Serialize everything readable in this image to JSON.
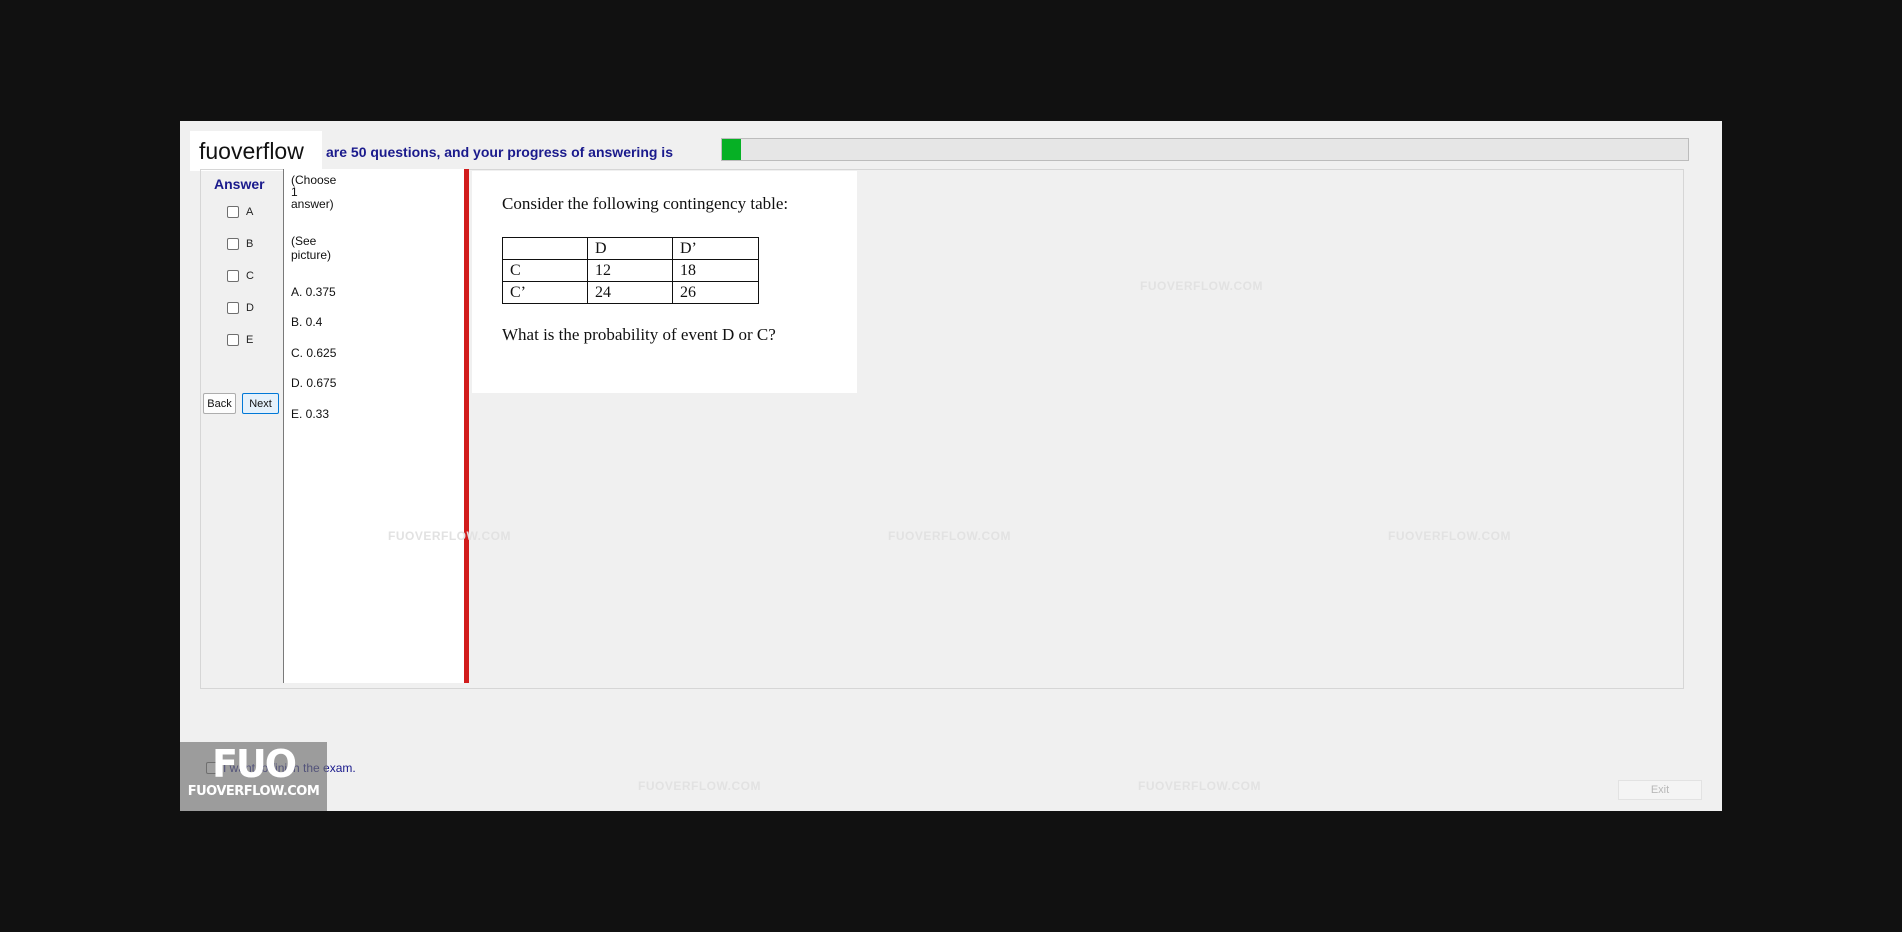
{
  "brand": {
    "logo_text": "fuoverflow"
  },
  "header": {
    "progress_text": "are 50 questions, and your progress of answering is",
    "progress_fraction": 0.02
  },
  "answer_panel": {
    "title": "Answer",
    "options": [
      "A",
      "B",
      "C",
      "D",
      "E"
    ],
    "back_label": "Back",
    "next_label": "Next"
  },
  "question_panel": {
    "instruction_lines": [
      "(Choose",
      "1",
      "answer)"
    ],
    "see_picture_lines": [
      "(See",
      "picture)"
    ],
    "choices": [
      "A.  0.375",
      "B.  0.4",
      "C.  0.625",
      "D.  0.675",
      "E.  0.33"
    ]
  },
  "picture": {
    "intro": "Consider the following contingency table:",
    "table": [
      [
        "",
        "D",
        "D’"
      ],
      [
        "C",
        "12",
        "18"
      ],
      [
        "C’",
        "24",
        "26"
      ]
    ],
    "question": "What is the probability of event D or C?"
  },
  "watermark_text": "FUOVERFLOW.COM",
  "footer": {
    "finish_label": "I want to finish the exam.",
    "exit_label": "Exit"
  },
  "corner_logo": {
    "big": "FUO",
    "small": "FUOVERFLOW.COM"
  },
  "colors": {
    "accent_text": "#1a1a8c",
    "progress_fill": "#06b025",
    "divider_red": "#d11c1c"
  }
}
